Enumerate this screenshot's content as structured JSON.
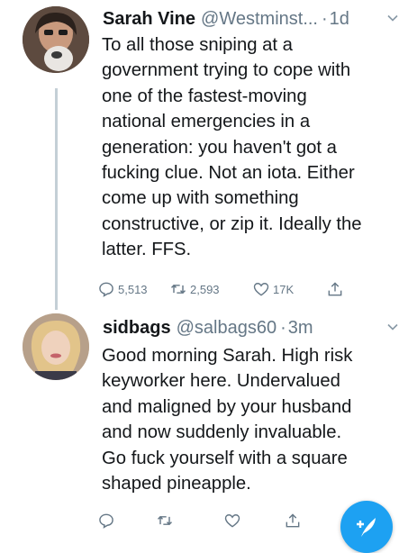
{
  "tweets": [
    {
      "name": "Sarah Vine",
      "handle": "@Westminst...",
      "separator": "·",
      "time": "1d",
      "lines": [
        "To all those sniping at a",
        "government trying to cope with",
        "one of the fastest-moving",
        "national emergencies in a",
        "generation: you haven't got a",
        "fucking clue. Not an iota. Either",
        "come up with something",
        "constructive, or zip it. Ideally the",
        "latter. FFS."
      ],
      "replies": "5,513",
      "retweets": "2,593",
      "likes": "17K"
    },
    {
      "name": "sidbags",
      "handle": "@salbags60",
      "separator": "·",
      "time": "3m",
      "lines": [
        "Good morning Sarah. High risk",
        "keyworker here. Undervalued",
        "and maligned by your husband",
        "and now suddenly invaluable.",
        "Go fuck yourself with a square",
        "shaped pineapple."
      ],
      "replies": "",
      "retweets": "",
      "likes": ""
    }
  ],
  "icons": {
    "reply": "reply-icon",
    "retweet": "retweet-icon",
    "like": "like-icon",
    "share": "share-icon",
    "more": "chevron-down-icon",
    "compose": "compose-icon"
  },
  "colors": {
    "accent": "#1da1f2",
    "secondary_text": "#657786",
    "thread_line": "#c4cfd6"
  }
}
